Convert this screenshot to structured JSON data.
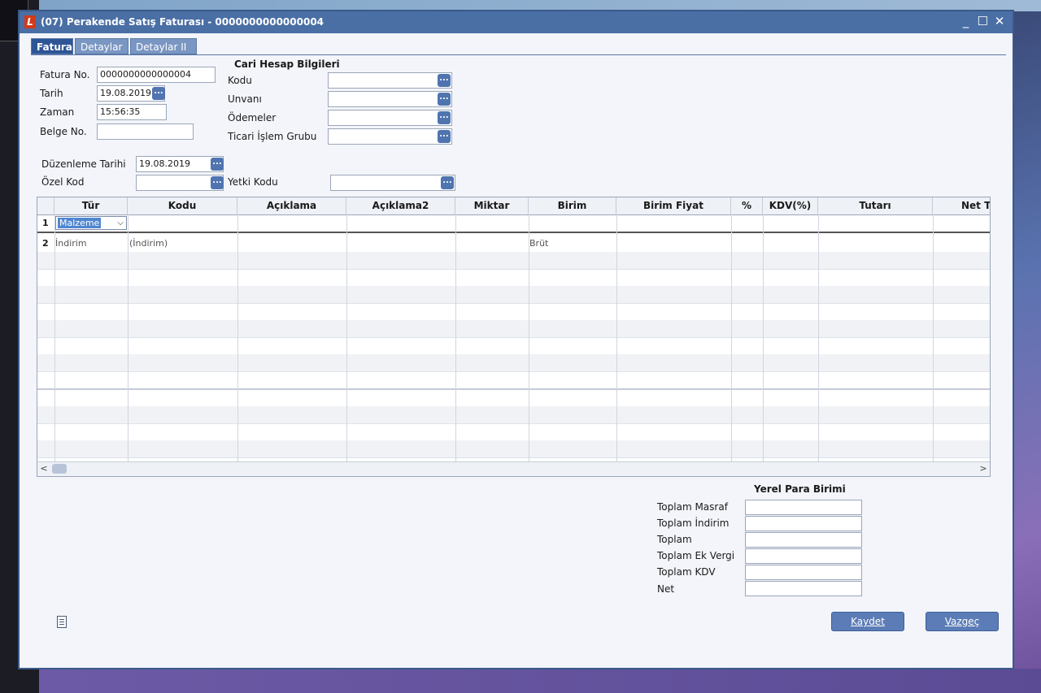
{
  "window": {
    "title": "(07) Perakende Satış Faturası - 0000000000000004",
    "logo": "L",
    "controls": [
      "_",
      "☐",
      "✕"
    ]
  },
  "tabs": [
    {
      "label": "Fatura",
      "active": true
    },
    {
      "label": "Detaylar",
      "active": false
    },
    {
      "label": "Detaylar II",
      "active": false
    }
  ],
  "form": {
    "fatura_no_label": "Fatura No.",
    "fatura_no": "0000000000000004",
    "tarih_label": "Tarih",
    "tarih": "19.08.2019",
    "zaman_label": "Zaman",
    "zaman": "15:56:35",
    "belge_no_label": "Belge No.",
    "belge_no": "",
    "duzenleme_tarihi_label": "Düzenleme Tarihi",
    "duzenleme_tarihi": "19.08.2019",
    "ozel_kod_label": "Özel Kod",
    "ozel_kod": "",
    "yetki_kodu_label": "Yetki Kodu",
    "yetki_kodu": ""
  },
  "cari": {
    "heading": "Cari Hesap Bilgileri",
    "kodu_label": "Kodu",
    "kodu": "",
    "unvani_label": "Unvanı",
    "unvani": "",
    "odemeler_label": "Ödemeler",
    "odemeler": "",
    "ticari_label": "Ticari İşlem Grubu",
    "ticari": ""
  },
  "ellipsis": "...",
  "grid": {
    "columns": [
      "Tür",
      "Kodu",
      "Açıklama",
      "Açıklama2",
      "Miktar",
      "Birim",
      "Birim Fiyat",
      "%",
      "KDV(%)",
      "Tutarı",
      "Net T"
    ],
    "rows": [
      {
        "num": "1",
        "tur": "Malzeme",
        "kodu": "",
        "birim": ""
      },
      {
        "num": "2",
        "tur": "İndirim",
        "kodu": "(İndirim)",
        "birim": "Brüt"
      }
    ],
    "scroll_left": "<",
    "scroll_right": ">",
    "combo_chevron": "⌵"
  },
  "totals": {
    "heading": "Yerel Para Birimi",
    "labels": [
      "Toplam Masraf",
      "Toplam İndirim",
      "Toplam",
      "Toplam Ek Vergi",
      "Toplam KDV",
      "Net"
    ]
  },
  "buttons": {
    "save": "Kaydet",
    "cancel": "Vazgeç"
  }
}
